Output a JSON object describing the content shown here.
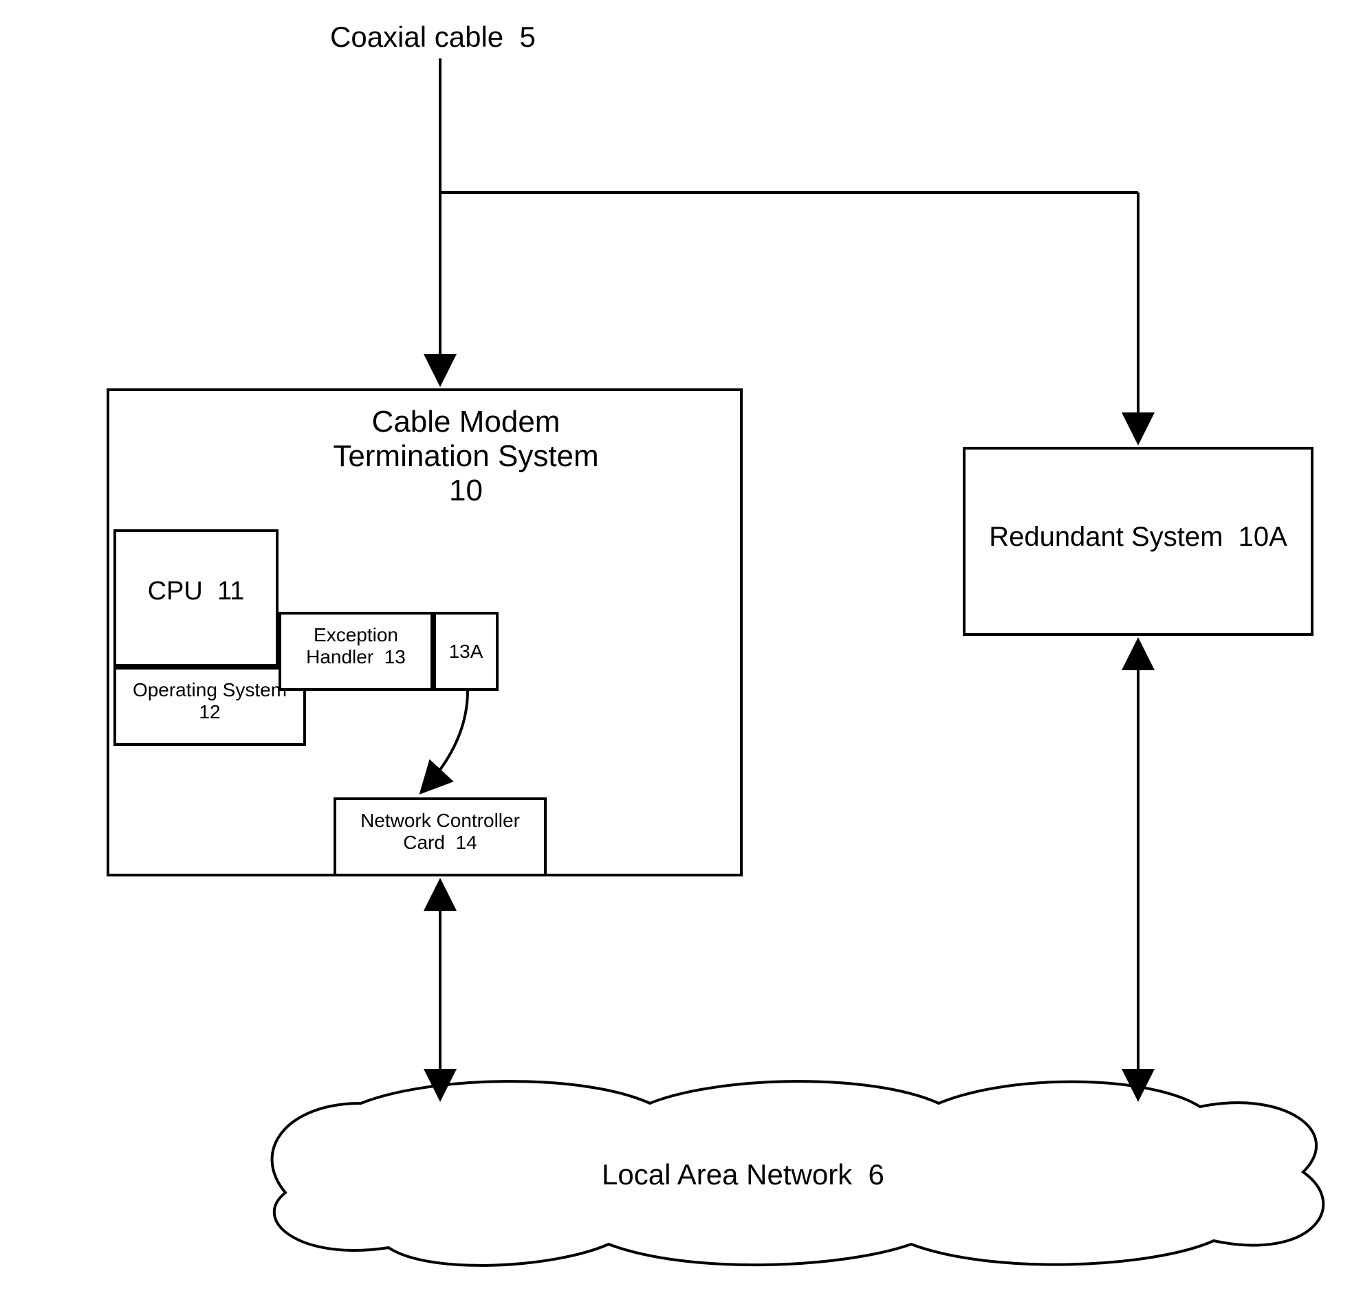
{
  "labels": {
    "coaxial_cable": {
      "text": "Coaxial cable",
      "ref": "5"
    },
    "cmts": {
      "line1": "Cable Modem",
      "line2": "Termination System",
      "ref": "10"
    },
    "cpu": {
      "text": "CPU",
      "ref": "11"
    },
    "os": {
      "line1": "Operating System",
      "ref": "12"
    },
    "exception_handler": {
      "line1": "Exception",
      "line2": "Handler",
      "ref": "13"
    },
    "eh_sub": {
      "ref": "13A"
    },
    "ncc": {
      "line1": "Network Controller",
      "line2": "Card",
      "ref": "14"
    },
    "redundant": {
      "text": "Redundant System",
      "ref": "10A"
    },
    "lan": {
      "text": "Local Area Network",
      "ref": "6"
    }
  }
}
